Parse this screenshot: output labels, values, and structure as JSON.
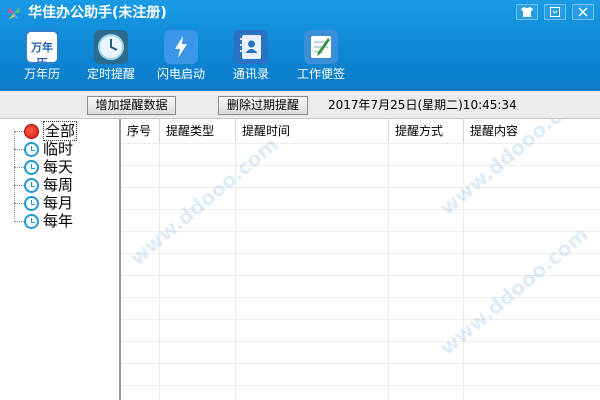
{
  "window": {
    "title": "华佳办公助手(未注册)",
    "controls": [
      "skin-icon",
      "restore-icon",
      "close-icon"
    ]
  },
  "toolbar": {
    "items": [
      {
        "label": "万年历",
        "icon": "calendar-icon",
        "icon_text": "万年历"
      },
      {
        "label": "定时提醒",
        "icon": "clock-icon"
      },
      {
        "label": "闪电启动",
        "icon": "flash-icon"
      },
      {
        "label": "通讯录",
        "icon": "contact-book-icon"
      },
      {
        "label": "工作便签",
        "icon": "notepad-icon"
      }
    ]
  },
  "actionbar": {
    "add_label": "增加提醒数据",
    "delete_label": "删除过期提醒",
    "datetime": "2017年7月25日(星期二)10:45:34"
  },
  "tree": {
    "items": [
      {
        "label": "全部",
        "selected": true,
        "icon": "red-dot-icon"
      },
      {
        "label": "临时",
        "icon": "alarm-clock-icon"
      },
      {
        "label": "每天",
        "icon": "alarm-clock-icon"
      },
      {
        "label": "每周",
        "icon": "alarm-clock-icon"
      },
      {
        "label": "每月",
        "icon": "alarm-clock-icon"
      },
      {
        "label": "每年",
        "icon": "alarm-clock-icon"
      }
    ]
  },
  "grid": {
    "columns": [
      "序号",
      "提醒类型",
      "提醒时间",
      "提醒方式",
      "提醒内容"
    ],
    "rows": []
  },
  "colors": {
    "header_blue": "#0d86d4",
    "bar_gray": "#ebebeb"
  }
}
